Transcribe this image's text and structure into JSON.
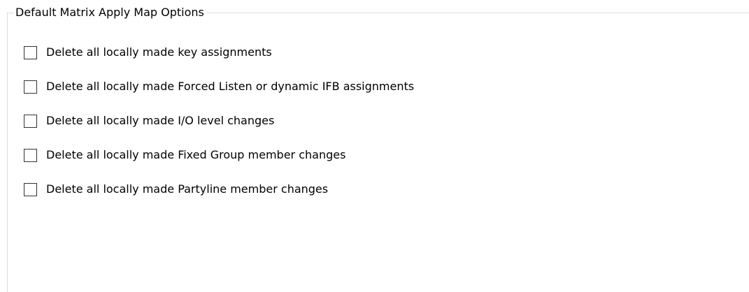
{
  "group": {
    "title": "Default Matrix Apply Map Options"
  },
  "options": [
    {
      "label": "Delete all locally made key assignments",
      "checked": false
    },
    {
      "label": "Delete all locally made Forced Listen or dynamic IFB assignments",
      "checked": false
    },
    {
      "label": "Delete all locally made I/O level changes",
      "checked": false
    },
    {
      "label": "Delete all locally made Fixed Group member changes",
      "checked": false
    },
    {
      "label": "Delete all locally made Partyline member changes",
      "checked": false
    }
  ]
}
